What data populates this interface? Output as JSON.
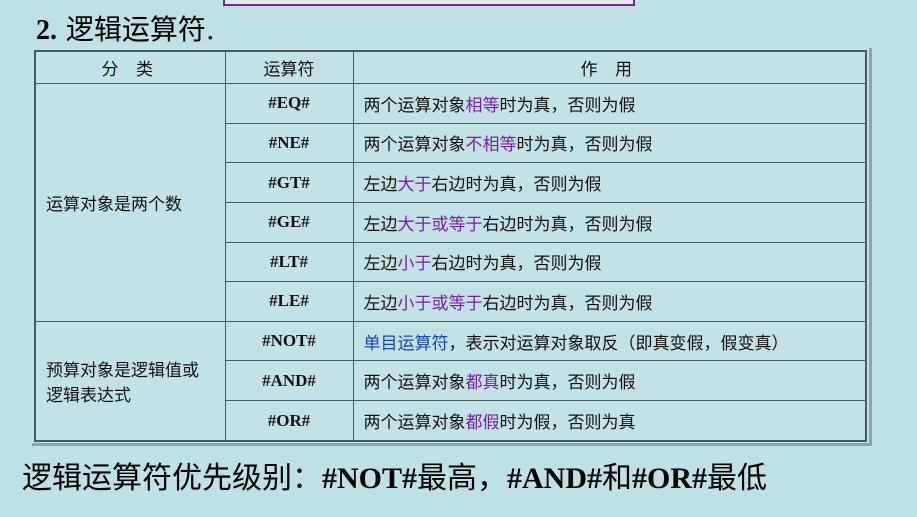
{
  "heading": {
    "number": "2.",
    "title": "逻辑运算符."
  },
  "table": {
    "headers": [
      "分 类",
      "运算符",
      "作 用"
    ],
    "groups": [
      {
        "category": "运算对象是两个数",
        "rows": [
          {
            "op": "#EQ#",
            "pre": "两个运算对象",
            "hl": "相等",
            "post": "时为真，否则为假"
          },
          {
            "op": "#NE#",
            "pre": "两个运算对象",
            "hl": "不相等",
            "post": "时为真，否则为假"
          },
          {
            "op": "#GT#",
            "pre": "左边",
            "hl": "大于",
            "post": "右边时为真，否则为假"
          },
          {
            "op": "#GE#",
            "pre": "左边",
            "hl": "大于或等于",
            "post": "右边时为真，否则为假"
          },
          {
            "op": "#LT#",
            "pre": "左边",
            "hl": "小于",
            "post": "右边时为真，否则为假"
          },
          {
            "op": "#LE#",
            "pre": "左边",
            "hl": "小于或等于",
            "post": "右边时为真，否则为假"
          }
        ]
      },
      {
        "category": "预算对象是逻辑值或逻辑表达式",
        "rows": [
          {
            "op": "#NOT#",
            "pre": "",
            "hl": "单目运算符",
            "post": "，表示对运算对象取反（即真变假，假变真）"
          },
          {
            "op": "#AND#",
            "pre": "两个运算对象",
            "hl": "都真",
            "post": "时为真，否则为假"
          },
          {
            "op": "#OR#",
            "pre": "两个运算对象",
            "hl": "都假",
            "post": "时为假，否则为真"
          }
        ]
      }
    ]
  },
  "footer": {
    "p1": "逻辑运算符优先级别：",
    "b1": "#NOT#",
    "p2": "最高，",
    "b2": "#AND#",
    "p3": "和",
    "b3": "#OR#",
    "p4": "最低"
  },
  "colors": {
    "background": "#bfe0e4",
    "highlight": "#7b1fa2",
    "highlight_alt": "#1a3fb0",
    "border": "#4a5a5e"
  }
}
